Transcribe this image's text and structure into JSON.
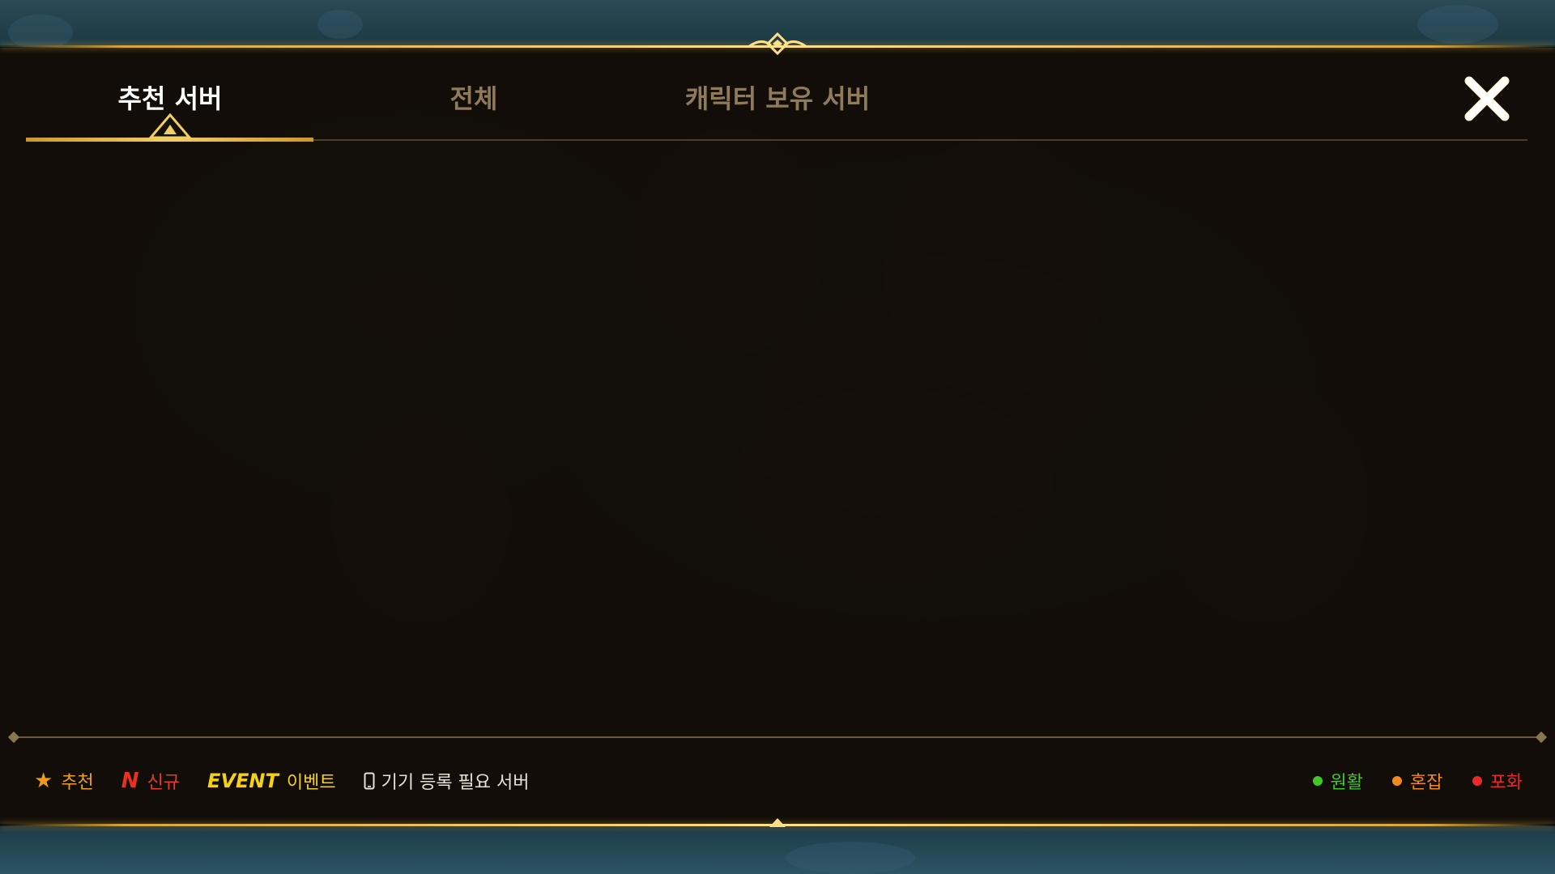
{
  "tabs": [
    {
      "label": "추천 서버",
      "active": true
    },
    {
      "label": "전체",
      "active": false
    },
    {
      "label": "캐릭터 보유 서버",
      "active": false
    }
  ],
  "close": {
    "icon": "close-icon"
  },
  "legend": {
    "recommended": {
      "label": "추천",
      "icon": "star-icon",
      "color": "#f09a1d"
    },
    "new": {
      "badge": "N",
      "label": "신규",
      "color": "#e8321e"
    },
    "event": {
      "badge": "EVENT",
      "label": "이벤트",
      "color": "#f4d213"
    },
    "device": {
      "label": "기기 등록 필요 서버",
      "icon": "phone-icon"
    }
  },
  "status": [
    {
      "label": "원활",
      "color": "#3fc72a"
    },
    {
      "label": "혼잡",
      "color": "#f08a1e"
    },
    {
      "label": "포화",
      "color": "#e82a2a"
    }
  ],
  "theme": {
    "accent": "#f1cf61",
    "tab_inactive": "#8f7a5a"
  }
}
